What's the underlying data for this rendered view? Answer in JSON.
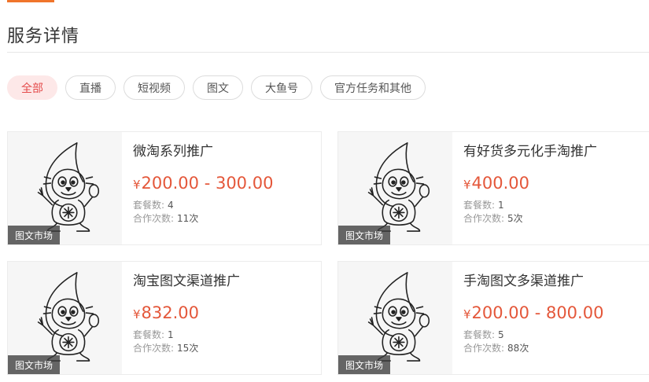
{
  "header": {
    "title": "服务详情"
  },
  "tabs": [
    {
      "label": "全部",
      "active": true
    },
    {
      "label": "直播",
      "active": false
    },
    {
      "label": "短视频",
      "active": false
    },
    {
      "label": "图文",
      "active": false
    },
    {
      "label": "大鱼号",
      "active": false
    },
    {
      "label": "官方任务和其他",
      "active": false
    }
  ],
  "labels": {
    "package_count": "套餐数:",
    "coop_count": "合作次数:"
  },
  "cards": [
    {
      "title": "微淘系列推广",
      "currency": "¥",
      "price": "200.00 - 300.00",
      "packages": "4",
      "coops": "11次",
      "badge": "图文市场"
    },
    {
      "title": "有好货多元化手淘推广",
      "currency": "¥",
      "price": "400.00",
      "packages": "1",
      "coops": "5次",
      "badge": "图文市场"
    },
    {
      "title": "淘宝图文渠道推广",
      "currency": "¥",
      "price": "832.00",
      "packages": "1",
      "coops": "15次",
      "badge": "图文市场"
    },
    {
      "title": "手淘图文多渠道推广",
      "currency": "¥",
      "price": "200.00 - 800.00",
      "packages": "5",
      "coops": "88次",
      "badge": "图文市场"
    }
  ],
  "colors": {
    "accent": "#f0752b",
    "price": "#e4573a",
    "active_tab_bg": "#fde8e8",
    "active_tab_text": "#e44b4b"
  },
  "icons": {
    "thumbnail": "mascot-illustration"
  }
}
